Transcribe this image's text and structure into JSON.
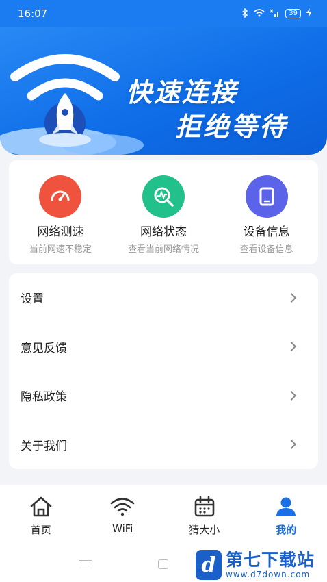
{
  "status_bar": {
    "time": "16:07",
    "icons": [
      "bluetooth-icon",
      "wifi-icon",
      "no-signal-icon",
      "battery-icon",
      "charging-icon"
    ],
    "battery": "39"
  },
  "banner": {
    "line1": "快速连接",
    "line2": "拒绝等待"
  },
  "features": [
    {
      "title": "网络测速",
      "subtitle": "当前网速不稳定",
      "icon": "speedometer-icon",
      "color": "#f0533d"
    },
    {
      "title": "网络状态",
      "subtitle": "查看当前网络情况",
      "icon": "network-search-icon",
      "color": "#22c08a"
    },
    {
      "title": "设备信息",
      "subtitle": "查看设备信息",
      "icon": "tablet-icon",
      "color": "#5b63e8"
    }
  ],
  "menu": [
    {
      "label": "设置"
    },
    {
      "label": "意见反馈"
    },
    {
      "label": "隐私政策"
    },
    {
      "label": "关于我们"
    }
  ],
  "nav": [
    {
      "label": "首页",
      "icon": "home-icon",
      "active": false
    },
    {
      "label": "WiFi",
      "icon": "wifi-icon",
      "active": false
    },
    {
      "label": "猜大小",
      "icon": "calendar-icon",
      "active": false
    },
    {
      "label": "我的",
      "icon": "person-icon",
      "active": true
    }
  ],
  "colors": {
    "accent": "#1a6fe6",
    "banner": "#1a7cf0"
  },
  "watermark": {
    "name": "第七下载站",
    "url": "www.d7down.com",
    "logo": "d"
  }
}
